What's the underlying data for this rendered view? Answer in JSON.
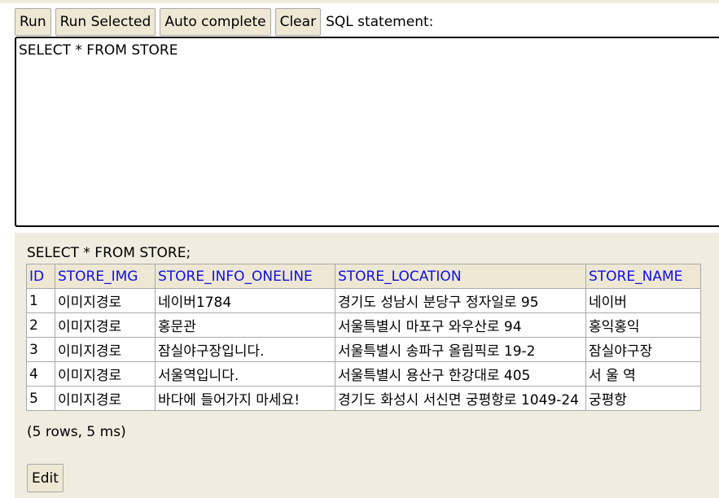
{
  "toolbar": {
    "run_label": "Run",
    "run_selected_label": "Run Selected",
    "auto_complete_label": "Auto complete",
    "clear_label": "Clear",
    "sql_statement_label": "SQL statement:"
  },
  "editor": {
    "value": "SELECT * FROM STORE"
  },
  "result": {
    "query": "SELECT * FROM STORE;",
    "columns": [
      "ID",
      "STORE_IMG",
      "STORE_INFO_ONELINE",
      "STORE_LOCATION",
      "STORE_NAME"
    ],
    "rows": [
      [
        "1",
        "이미지경로",
        "네이버1784",
        "경기도 성남시 분당구 정자일로 95",
        "네이버"
      ],
      [
        "2",
        "이미지경로",
        "홍문관",
        "서울특별시 마포구 와우산로 94",
        "홍익홍익"
      ],
      [
        "3",
        "이미지경로",
        "잠실야구장입니다.",
        "서울특별시 송파구 올림픽로 19-2",
        "잠실야구장"
      ],
      [
        "4",
        "이미지경로",
        "서울역입니다.",
        "서울특별시 용산구 한강대로 405",
        "서 울 역"
      ],
      [
        "5",
        "이미지경로",
        "바다에 들어가지 마세요!",
        "경기도 화성시 서신면 궁평항로 1049-24",
        "궁평항"
      ]
    ],
    "stats": "(5 rows, 5 ms)",
    "edit_label": "Edit"
  },
  "colors": {
    "panel_background": "#f0ecdf",
    "button_background": "#ede7d4",
    "header_text": "#1010e0"
  }
}
